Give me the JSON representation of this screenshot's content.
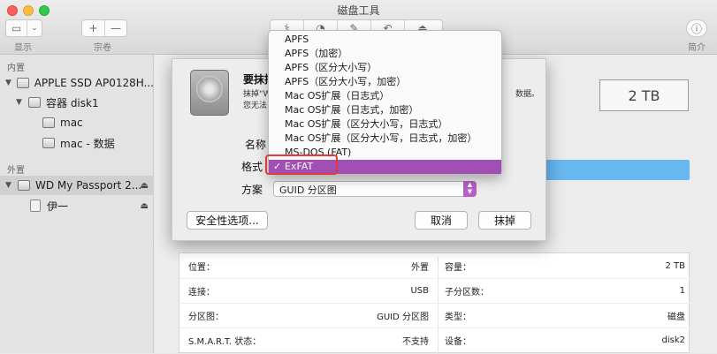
{
  "window": {
    "title": "磁盘工具"
  },
  "toolbar": {
    "view_label": "显示",
    "volume_label": "宗卷",
    "info_label": "简介",
    "add_label": "+",
    "remove_label": "—"
  },
  "sidebar": {
    "internal_header": "内置",
    "external_header": "外置",
    "items": [
      {
        "label": "APPLE SSD AP0128H..."
      },
      {
        "label": "容器 disk1"
      },
      {
        "label": "mac"
      },
      {
        "label": "mac - 数据"
      },
      {
        "label": "WD My Passport 2..."
      },
      {
        "label": "伊一"
      }
    ]
  },
  "main": {
    "capacity_display": "2 TB"
  },
  "sheet": {
    "title": "要抹掉",
    "description_line1": "抹掉“W",
    "description_line1_end": "数据。",
    "description_line2": "您无法",
    "name_label": "名称",
    "format_label": "格式",
    "scheme_label": "方案",
    "scheme_value": "GUID 分区图",
    "security_button": "安全性选项...",
    "cancel_button": "取消",
    "erase_button": "抹掉"
  },
  "format_menu": {
    "options": [
      "APFS",
      "APFS（加密）",
      "APFS（区分大小写）",
      "APFS（区分大小写，加密）",
      "Mac OS扩展（日志式）",
      "Mac OS扩展（日志式，加密）",
      "Mac OS扩展（区分大小写，日志式）",
      "Mac OS扩展（区分大小写，日志式，加密）",
      "MS-DOS (FAT)",
      "ExFAT"
    ],
    "selected": "ExFAT",
    "check_mark": "✓"
  },
  "info": {
    "left": [
      {
        "label": "位置：",
        "value": "外置"
      },
      {
        "label": "连接：",
        "value": "USB"
      },
      {
        "label": "分区图：",
        "value": "GUID 分区图"
      },
      {
        "label": "S.M.A.R.T. 状态：",
        "value": "不支持"
      }
    ],
    "right": [
      {
        "label": "容量：",
        "value": "2 TB"
      },
      {
        "label": "子分区数：",
        "value": "1"
      },
      {
        "label": "类型：",
        "value": "磁盘"
      },
      {
        "label": "设备：",
        "value": "disk2"
      }
    ]
  },
  "colors": {
    "accent_purple": "#a14fb5",
    "highlight_red": "#e53935",
    "bar_blue": "#67b7f0"
  }
}
